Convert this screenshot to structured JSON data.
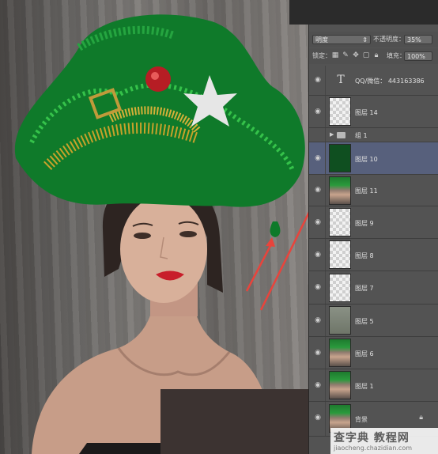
{
  "canvas": {
    "annotation_color": "#e8443c"
  },
  "layers_panel": {
    "blend_mode": "明度",
    "opacity_label": "不透明度：",
    "opacity_value": "35%",
    "lock_label": "锁定：",
    "lock_icons": [
      "lock-transparent-icon",
      "brush-icon",
      "move-icon",
      "artboard-icon",
      "lock-icon"
    ],
    "fill_label": "填充：",
    "fill_value": "100%",
    "layers": [
      {
        "name": "QQ/微信： 443163386",
        "kind": "text",
        "visible": true,
        "selected": false
      },
      {
        "name": "图层 14",
        "kind": "checker",
        "visible": true,
        "selected": false
      },
      {
        "name": "组 1",
        "kind": "group",
        "visible": false,
        "selected": false
      },
      {
        "name": "图层 10",
        "kind": "green",
        "visible": true,
        "selected": true
      },
      {
        "name": "图层 11",
        "kind": "photo",
        "visible": true,
        "selected": false
      },
      {
        "name": "图层 9",
        "kind": "checker",
        "visible": true,
        "selected": false
      },
      {
        "name": "图层 8",
        "kind": "checker",
        "visible": true,
        "selected": false
      },
      {
        "name": "图层 7",
        "kind": "checker",
        "visible": true,
        "selected": false
      },
      {
        "name": "图层 5",
        "kind": "gray",
        "visible": true,
        "selected": false
      },
      {
        "name": "图层 6",
        "kind": "photo",
        "visible": true,
        "selected": false
      },
      {
        "name": "图层 1",
        "kind": "photo",
        "visible": true,
        "selected": false
      },
      {
        "name": "背景",
        "kind": "photo",
        "visible": true,
        "selected": false,
        "locked": true
      }
    ]
  },
  "watermark": {
    "title": "查字典 教程网",
    "url": "jiaocheng.chazidian.com"
  }
}
